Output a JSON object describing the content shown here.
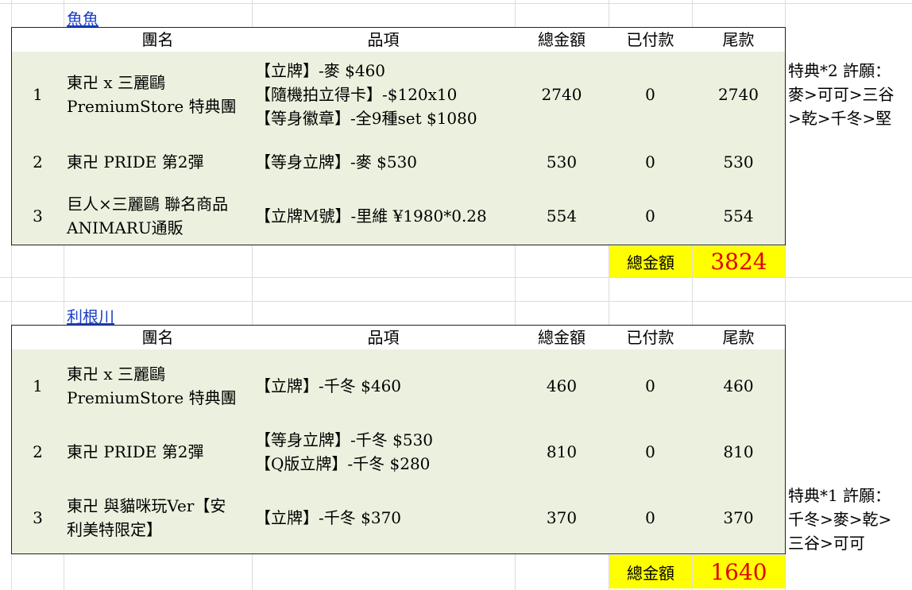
{
  "sections": [
    {
      "link": "魚魚",
      "headers": [
        "團名",
        "品項",
        "總金額",
        "已付款",
        "尾款"
      ],
      "rows": [
        {
          "no": "1",
          "group": "東卍 x 三麗鷗\nPremiumStore 特典團",
          "items": "【立牌】-麥 $460\n【隨機拍立得卡】-$120x10\n【等身徽章】-全9種set $1080",
          "total": "2740",
          "paid": "0",
          "balance": "2740"
        },
        {
          "no": "2",
          "group": "東卍 PRIDE 第2彈",
          "items": "【等身立牌】-麥 $530",
          "total": "530",
          "paid": "0",
          "balance": "530"
        },
        {
          "no": "3",
          "group": "巨人×三麗鷗 聯名商品\nANIMARU通販",
          "items": "【立牌M號】-里維 ¥1980*0.28",
          "total": "554",
          "paid": "0",
          "balance": "554"
        }
      ],
      "note": "特典*2 許願：\n麥>可可>三谷\n>乾>千冬>堅",
      "total_label": "總金額",
      "total_value": "3824"
    },
    {
      "link": "利根川",
      "headers": [
        "團名",
        "品項",
        "總金額",
        "已付款",
        "尾款"
      ],
      "rows": [
        {
          "no": "1",
          "group": "東卍 x 三麗鷗\nPremiumStore 特典團",
          "items": "【立牌】-千冬 $460",
          "total": "460",
          "paid": "0",
          "balance": "460"
        },
        {
          "no": "2",
          "group": "東卍 PRIDE 第2彈",
          "items": "【等身立牌】-千冬 $530\n【Q版立牌】-千冬 $280",
          "total": "810",
          "paid": "0",
          "balance": "810"
        },
        {
          "no": "3",
          "group": "東卍 與貓咪玩Ver【安\n利美特限定】",
          "items": "【立牌】-千冬 $370",
          "total": "370",
          "paid": "0",
          "balance": "370"
        }
      ],
      "note": "特典*1 許願：\n千冬>麥>乾>\n三谷>可可",
      "total_label": "總金額",
      "total_value": "1640"
    }
  ]
}
